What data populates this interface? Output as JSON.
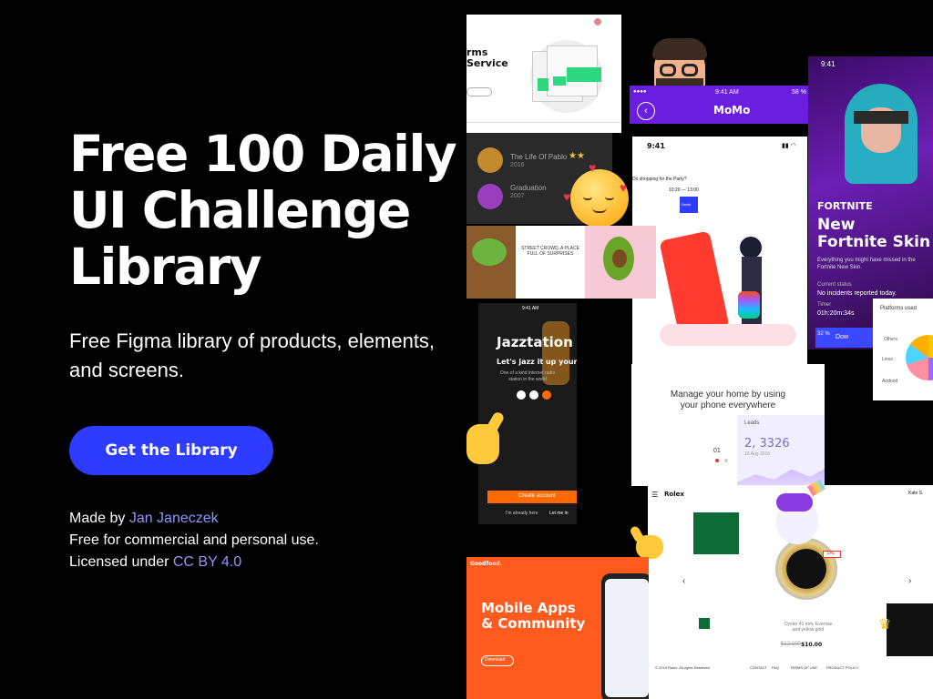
{
  "hero": {
    "title_line1": "Free 100 Daily",
    "title_line2": "UI Challenge",
    "title_line3": "Library",
    "subtitle_line1": "Free Figma library of products, elements,",
    "subtitle_line2": "and screens.",
    "cta_label": "Get the Library"
  },
  "credits": {
    "made_by_prefix": "Made by ",
    "author": "Jan Janeczek",
    "usage": "Free for commercial and personal use.",
    "license_prefix": "Licensed under ",
    "license": "CC BY 4.0"
  },
  "colors": {
    "background": "#000000",
    "cta": "#2d3cff",
    "link": "#8f96ff"
  },
  "collage": {
    "terms": {
      "title1": "rms",
      "title2": "Service"
    },
    "playlist": {
      "item1": "The Life Of Pablo",
      "year1": "2016",
      "item2": "Graduation",
      "year2": "2007"
    },
    "momo": {
      "time": "9:41 AM",
      "battery": "58 %",
      "title": "MoMo"
    },
    "fortnite": {
      "time": "9:41",
      "logo": "FORTNITE",
      "headline1": "New",
      "headline2": "Fortnite Skin",
      "desc": "Everything you might have missed in the Fortnite New Skin.",
      "status_label": "Current status",
      "status": "No incidents reported today.",
      "timer_label": "Timer",
      "timer": "01h:20m:34s",
      "percent": "32 %",
      "button": "Dow"
    },
    "app": {
      "time": "9:41",
      "q1": "Do shopping for the Party?",
      "pill1": "10:20 — 13:00",
      "btn": "Detail"
    },
    "food": {
      "heading": "STREET CROWD. A PLACE FULL OF SURPRISES"
    },
    "jazz": {
      "time": "9:41 AM",
      "brand": "Jazztation",
      "tagline": "Let's jazz it up your life",
      "desc": "One of a kind internet radio station in the world",
      "create": "Create account",
      "login_prefix": "I'm already here",
      "login": "Let me in"
    },
    "home": {
      "headline1": "Manage your home by using",
      "headline2": "your phone everywhere",
      "leads_label": "Leads",
      "leads_value": "2, 3326",
      "leads_date": "10 Aug 2016",
      "page": "01"
    },
    "platforms": {
      "title": "Platforms used",
      "p1": "Others",
      "p2": "Linux",
      "p3": "Android"
    },
    "rolex": {
      "brand": "Rolex",
      "badge": "SAL",
      "desc1": "Oyster 41 mm, Everose",
      "desc2": "and yellow gold",
      "old_price": "$12,100",
      "price": "$10.00",
      "nav1": "CONTACT",
      "nav2": "FAQ",
      "nav3": "TERMS OF USE",
      "nav4": "PRODUCT POLICY",
      "copyright": "© 2019 Rolex. All rights Reserved",
      "user": "Kate S."
    },
    "orange": {
      "brand": "Goodfood.",
      "headline1": "Mobile Apps",
      "headline2": "& Community",
      "pill": "Download"
    }
  }
}
